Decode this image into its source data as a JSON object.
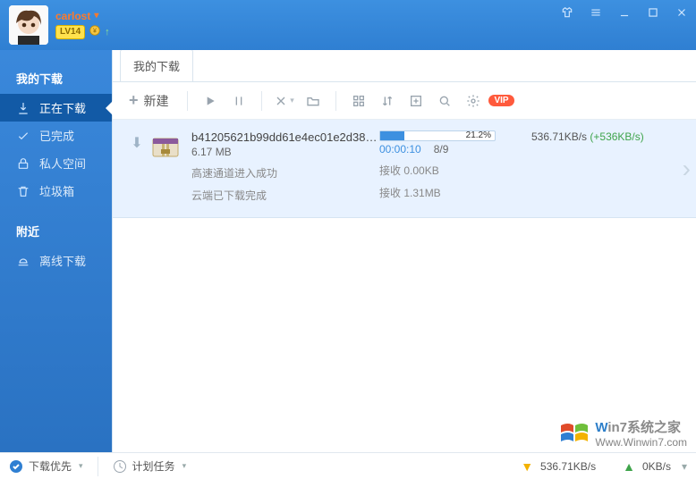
{
  "user": {
    "name": "carlost",
    "level": "LV14"
  },
  "sidebar": {
    "group1_title": "我的下载",
    "items": [
      {
        "label": "正在下载"
      },
      {
        "label": "已完成"
      },
      {
        "label": "私人空间"
      },
      {
        "label": "垃圾箱"
      }
    ],
    "group2_title": "附近",
    "items2": [
      {
        "label": "离线下载"
      }
    ]
  },
  "tabs": {
    "active": "我的下载"
  },
  "toolbar": {
    "new_label": "新建"
  },
  "download": {
    "filename": "b41205621b99dd61e4ec01e2d3857...",
    "size": "6.17 MB",
    "msg1": "高速通道进入成功",
    "msg2": "云端已下载完成",
    "progress_pct": 21.2,
    "progress_pct_label": "21.2%",
    "elapsed": "00:00:10",
    "parts": "8/9",
    "recv1_label": "接收 0.00KB",
    "recv2_label": "接收 1.31MB",
    "speed": "536.71KB/s",
    "bonus": "(+536KB/s)"
  },
  "status": {
    "priority": "下载优先",
    "schedule": "计划任务",
    "down_speed": "536.71KB/s",
    "up_speed": "0KB/s"
  },
  "watermark": {
    "brand_w": "W",
    "brand_in": "in7",
    "brand_rest": "系统之家",
    "url": "Www.Winwin7.com"
  },
  "vip_badge": "VIP"
}
